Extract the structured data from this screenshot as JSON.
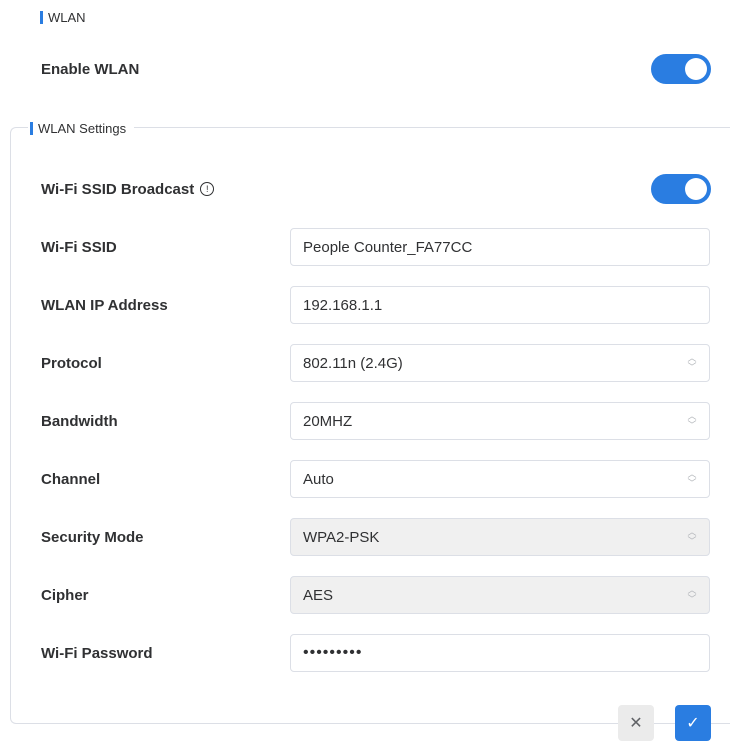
{
  "wlan_section": {
    "title": "WLAN"
  },
  "enable_wlan": {
    "label": "Enable WLAN",
    "enabled": true
  },
  "settings": {
    "title": "WLAN Settings",
    "ssid_broadcast": {
      "label": "Wi-Fi SSID Broadcast",
      "info_icon": "info-circle-icon",
      "enabled": true
    },
    "ssid": {
      "label": "Wi-Fi SSID",
      "value": "People Counter_FA77CC"
    },
    "ip": {
      "label": "WLAN IP Address",
      "value": "192.168.1.1"
    },
    "protocol": {
      "label": "Protocol",
      "value": "802.11n (2.4G)"
    },
    "bandwidth": {
      "label": "Bandwidth",
      "value": "20MHZ"
    },
    "channel": {
      "label": "Channel",
      "value": "Auto"
    },
    "security_mode": {
      "label": "Security Mode",
      "value": "WPA2-PSK"
    },
    "cipher": {
      "label": "Cipher",
      "value": "AES"
    },
    "password": {
      "label": "Wi-Fi Password",
      "value": "•••••••••"
    }
  },
  "actions": {
    "cancel_icon": "✕",
    "confirm_icon": "✓"
  },
  "colors": {
    "accent": "#2a7de1",
    "disabled_bg": "#f0f0f0"
  }
}
